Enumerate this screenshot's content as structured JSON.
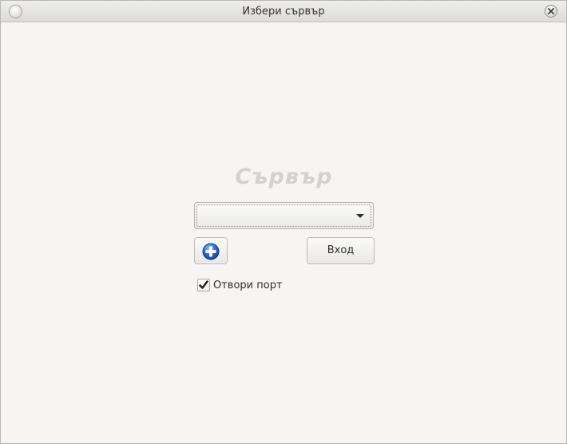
{
  "window": {
    "title": "Избери сървър"
  },
  "form": {
    "heading": "Сървър",
    "server_select": {
      "selected_value": ""
    },
    "add_button_icon": "add-circle-icon",
    "login_label": "Вход",
    "open_port": {
      "label": "Отвори порт",
      "checked": true
    }
  },
  "colors": {
    "window_bg": "#f6f5f3",
    "heading": "#d3d2cf",
    "add_icon_blue": "#2a66d4"
  }
}
